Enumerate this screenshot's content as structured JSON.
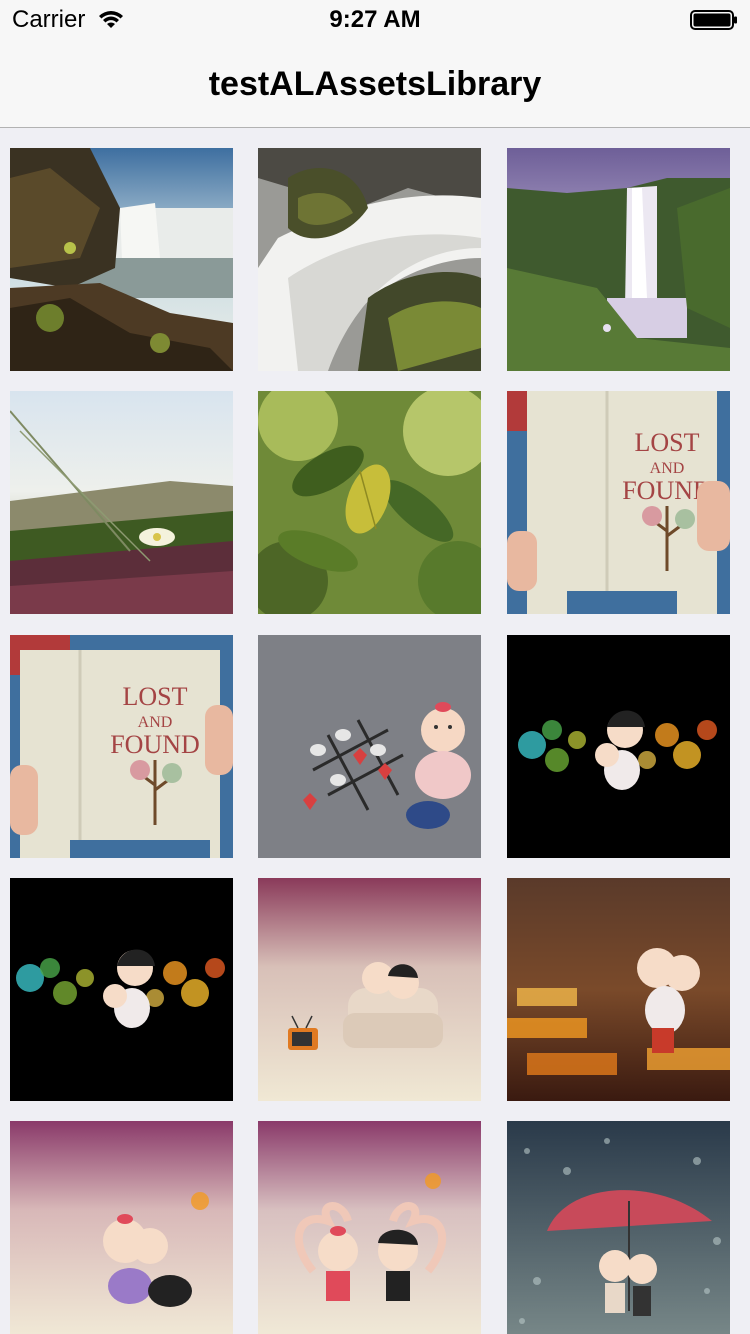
{
  "status_bar": {
    "carrier": "Carrier",
    "time": "9:27 AM",
    "wifi_icon": "wifi-icon",
    "battery_icon": "battery-icon"
  },
  "nav": {
    "title": "testALAssetsLibrary"
  },
  "photos": [
    {
      "subject": "waterfall-landscape"
    },
    {
      "subject": "waterfall-closeup"
    },
    {
      "subject": "waterfall-misty-purple"
    },
    {
      "subject": "grass-flower-field"
    },
    {
      "subject": "green-leaves"
    },
    {
      "subject": "book-lost-and-found"
    },
    {
      "subject": "book-lost-and-found"
    },
    {
      "subject": "cartoon-couple-tictactoe"
    },
    {
      "subject": "cartoon-couple-bokeh-dark"
    },
    {
      "subject": "cartoon-couple-bokeh-dark"
    },
    {
      "subject": "cartoon-couple-sofa-tv"
    },
    {
      "subject": "cartoon-couple-classroom"
    },
    {
      "subject": "cartoon-couple-hug"
    },
    {
      "subject": "cartoon-couple-heart"
    },
    {
      "subject": "cartoon-couple-umbrella-rain"
    }
  ],
  "book": {
    "title_line1": "LOST",
    "title_line2": "AND",
    "title_line3": "FOUND"
  },
  "colors": {
    "nav_background": "#f7f7f7",
    "page_background": "#efeff4",
    "separator": "#b2b2b2"
  }
}
